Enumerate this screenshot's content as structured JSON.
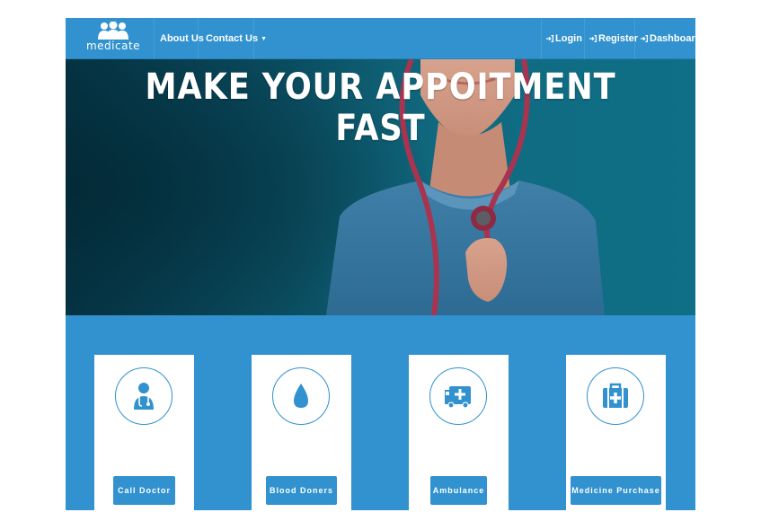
{
  "brand": {
    "name": "medicate",
    "icon": "people-logo-icon"
  },
  "nav": {
    "about": "About Us",
    "contact": "Contact Us",
    "login": "Login",
    "register": "Register",
    "dashboard": "Dashboard"
  },
  "hero": {
    "title": "MAKE YOUR APPOITMENT FAST"
  },
  "services": [
    {
      "label": "Call Doctor",
      "icon": "doctor-icon"
    },
    {
      "label": "Blood Doners",
      "icon": "blood-drop-icon"
    },
    {
      "label": "Ambulance",
      "icon": "ambulance-icon"
    },
    {
      "label": "Medicine Purchase",
      "icon": "first-aid-kit-icon"
    }
  ],
  "colors": {
    "primary": "#3192cf",
    "hero_dark": "#053444",
    "white": "#ffffff"
  }
}
